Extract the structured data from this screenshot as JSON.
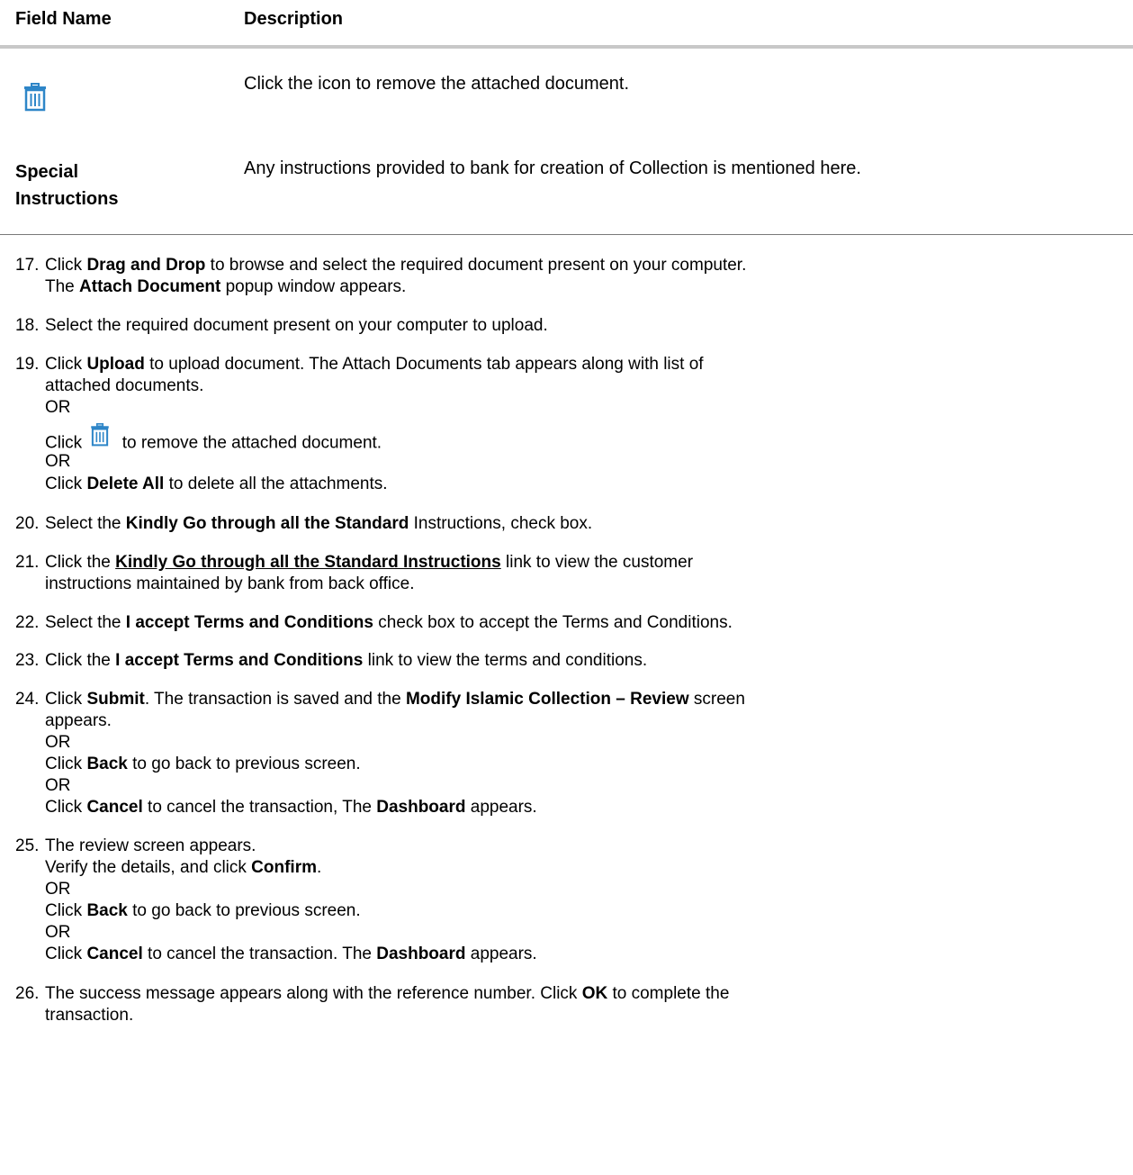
{
  "table": {
    "headers": {
      "field": "Field Name",
      "description": "Description"
    },
    "rows": [
      {
        "field": "",
        "icon": "trash-icon",
        "description": "Click the icon to remove the attached document."
      },
      {
        "field_line1": "Special",
        "field_line2": "Instructions",
        "description": "Any instructions provided to bank for creation of Collection is mentioned here."
      }
    ]
  },
  "steps": {
    "s17": {
      "num": "17.",
      "a": "Click ",
      "b": "Drag and Drop",
      "c": " to browse and select the required document present on your computer.",
      "l2a": "The ",
      "l2b": "Attach Document",
      "l2c": " popup window appears."
    },
    "s18": {
      "num": "18.",
      "a": "Select the required document present on your computer to upload."
    },
    "s19": {
      "num": "19.",
      "a": "Click ",
      "b": "Upload",
      "c": " to upload document. The Attach Documents tab appears along with list of",
      "l2": "attached documents.",
      "or1": " OR",
      "l4a": "Click ",
      "l4c": " to remove the attached document.",
      "or2": "OR",
      "l6a": "Click ",
      "l6b": "Delete All",
      "l6c": " to delete all the attachments."
    },
    "s20": {
      "num": "20.",
      "a": "Select the ",
      "b": "Kindly Go through all the Standard",
      "c": " Instructions, check box."
    },
    "s21": {
      "num": "21.",
      "a": "Click the ",
      "b": "Kindly Go through all the Standard Instructions",
      "c": " link to view the customer",
      "l2": "instructions maintained by bank from back office."
    },
    "s22": {
      "num": "22.",
      "a": "Select the ",
      "b": "I accept Terms and Conditions",
      "c": " check box to accept the Terms and Conditions."
    },
    "s23": {
      "num": "23.",
      "a": "Click the ",
      "b": "I accept Terms and Conditions",
      "c": " link to view the terms and conditions."
    },
    "s24": {
      "num": "24.",
      "a": "Click ",
      "b": "Submit",
      "c": ". The transaction is saved and the ",
      "d": "Modify Islamic Collection – Review",
      "e": " screen",
      "l2": "appears.",
      "or1": "OR",
      "l4a": "Click ",
      "l4b": "Back",
      "l4c": " to go back to previous screen.",
      "or2": "OR",
      "l6a": "Click ",
      "l6b": "Cancel",
      "l6c": " to cancel the transaction, The ",
      "l6d": "Dashboard",
      "l6e": " appears."
    },
    "s25": {
      "num": "25.",
      "a": "The review screen appears.",
      "l2a": "Verify the details, and click ",
      "l2b": "Confirm",
      "l2c": ".",
      "or1": "OR",
      "l4a": "Click ",
      "l4b": "Back",
      "l4c": " to go back to previous screen.",
      "or2": "OR",
      "l6a": "Click ",
      "l6b": "Cancel",
      "l6c": " to cancel the transaction. The ",
      "l6d": "Dashboard",
      "l6e": " appears."
    },
    "s26": {
      "num": "26.",
      "a": "The success message appears along with the reference number. Click ",
      "b": "OK",
      "c": " to complete the",
      "l2": "transaction."
    }
  }
}
